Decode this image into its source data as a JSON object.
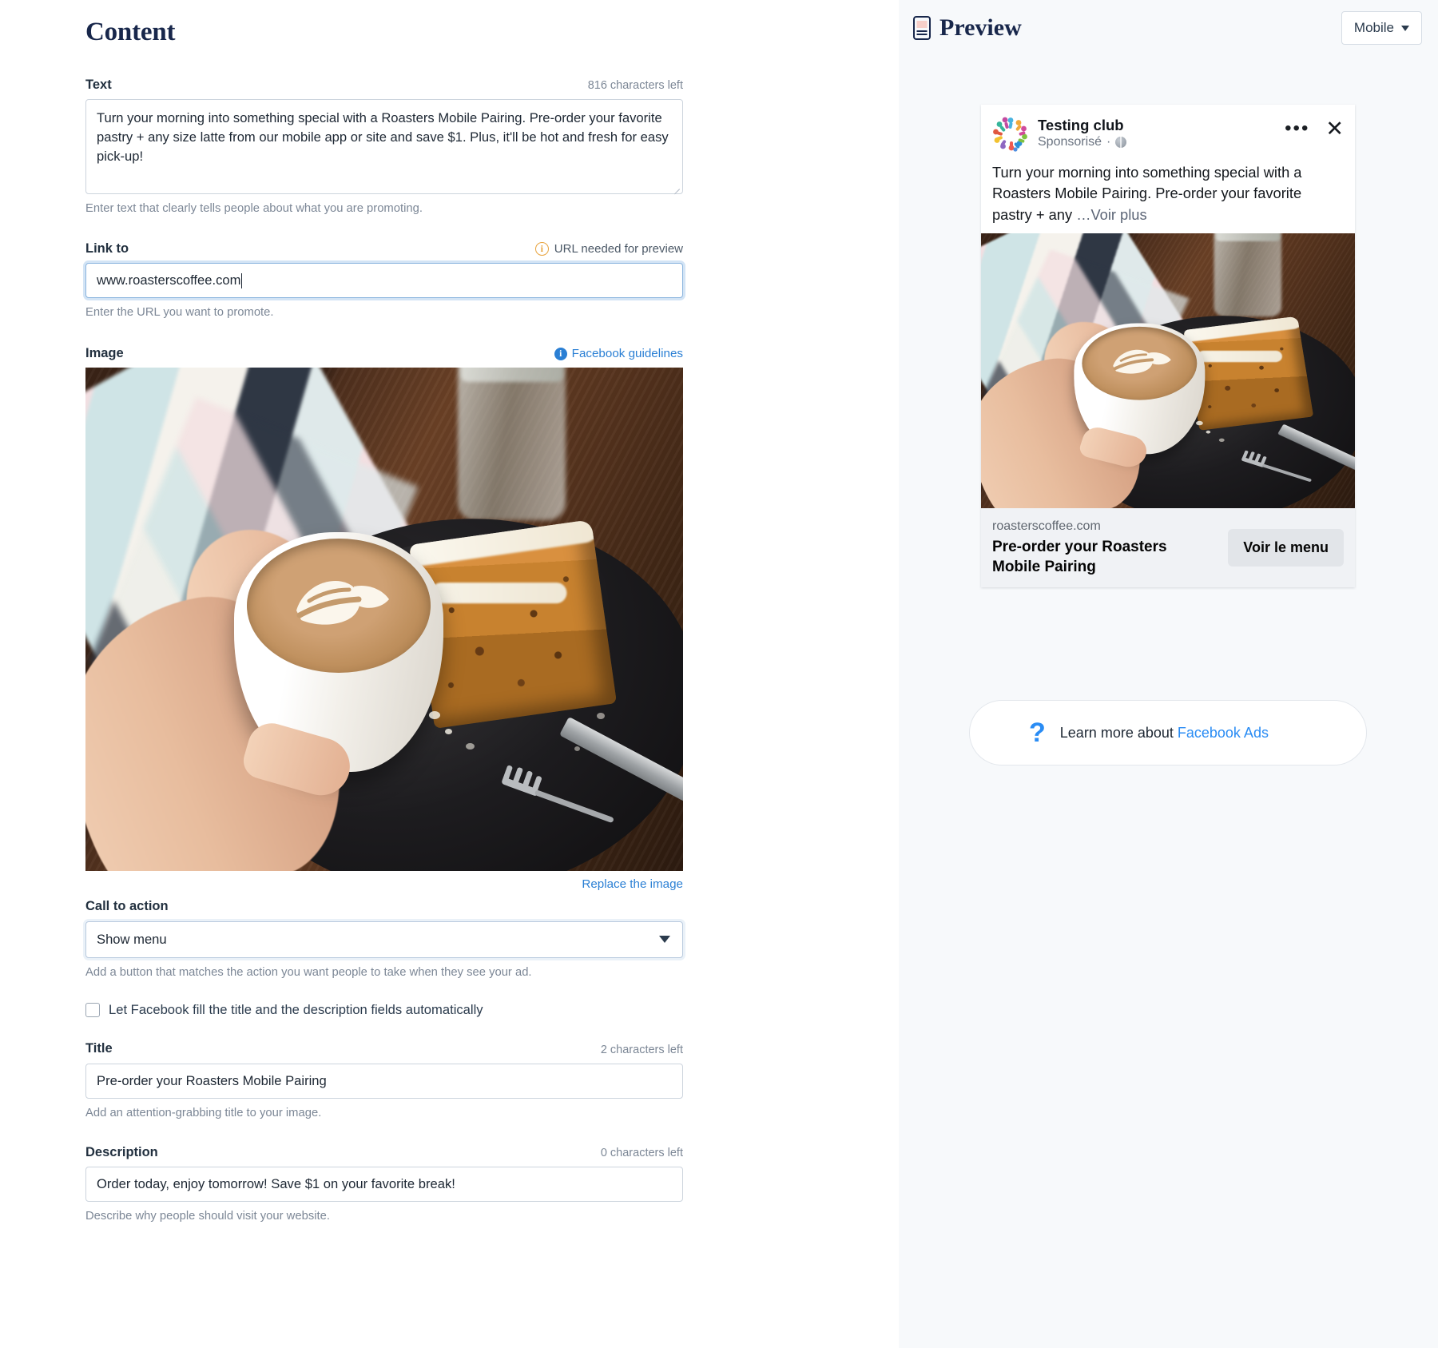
{
  "colors": {
    "accent_blue": "#2a7fd4",
    "fb_blue": "#2a8cf4",
    "warn_amber": "#e8a33d",
    "heading_navy": "#18274b",
    "panel_bg": "#f7f9fb",
    "footer_bg": "#f0f2f5"
  },
  "form": {
    "section_title": "Content",
    "text_field": {
      "label": "Text",
      "counter": "816 characters left",
      "value": "Turn your morning into something special with a Roasters Mobile Pairing. Pre-order your favorite pastry + any size latte from our mobile app or site and save $1. Plus, it'll be hot and fresh for easy pick-up!",
      "help": "Enter text that clearly tells people about what you are promoting.",
      "resize_handle_icon": "resize-handle-icon"
    },
    "link_field": {
      "label": "Link to",
      "warning": "URL needed for preview",
      "warning_icon": "info-circle-icon",
      "value": "www.roasterscoffee.com",
      "help": "Enter the URL you want to promote."
    },
    "image_field": {
      "label": "Image",
      "guidelines_link": "Facebook guidelines",
      "guidelines_icon": "info-circle-icon",
      "replace_link": "Replace the image",
      "photo_alt": "hand holding latte with leaf art beside carrot cake slice on slate plate"
    },
    "cta_field": {
      "label": "Call to action",
      "value": "Show menu",
      "help": "Add a button that matches the action you want people to take when they see your ad.",
      "caret_icon": "chevron-down-icon"
    },
    "autofill": {
      "label": "Let Facebook fill the title and the description fields automatically",
      "checked": false
    },
    "title_field": {
      "label": "Title",
      "counter": "2 characters left",
      "value": "Pre-order your Roasters Mobile Pairing",
      "help": "Add an attention-grabbing title to your image."
    },
    "description_field": {
      "label": "Description",
      "counter": "0 characters left",
      "value": "Order today, enjoy tomorrow! Save $1 on your favorite break!",
      "help": "Describe why people should visit your website."
    }
  },
  "preview": {
    "title": "Preview",
    "title_icon": "mobile-phone-icon",
    "device_selector": {
      "value": "Mobile",
      "caret_icon": "chevron-down-icon"
    },
    "ad": {
      "page_name": "Testing club",
      "sponsored": "Sponsorisé",
      "sponsored_separator": "·",
      "globe_icon": "globe-icon",
      "avatar_icon": "avatar-people-ring-icon",
      "more_icon": "ellipsis-icon",
      "close_icon": "close-icon",
      "body_text": "Turn your morning into something special with a Roasters Mobile Pairing. Pre-order your favorite pastry + any",
      "see_more": "…Voir plus",
      "link_domain": "roasterscoffee.com",
      "link_headline": "Pre-order your Roasters Mobile Pairing",
      "cta_button": "Voir le menu"
    },
    "learn_more": {
      "icon": "question-mark-icon",
      "prefix": "Learn more about ",
      "link": "Facebook Ads"
    }
  }
}
